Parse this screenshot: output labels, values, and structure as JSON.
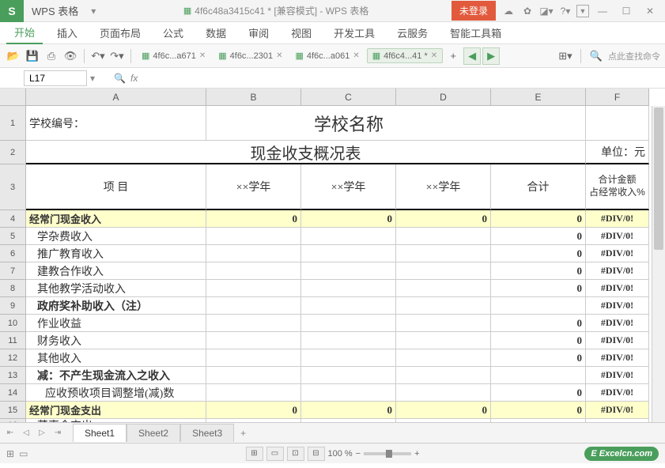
{
  "titlebar": {
    "app": "WPS 表格",
    "file": "4f6c48a3415c41 * [兼容模式] - WPS 表格",
    "login": "未登录"
  },
  "menu": {
    "tabs": [
      "开始",
      "插入",
      "页面布局",
      "公式",
      "数据",
      "审阅",
      "视图",
      "开发工具",
      "云服务",
      "智能工具箱"
    ],
    "active": 0
  },
  "doctabs": [
    {
      "label": "4f6c...a671",
      "active": false
    },
    {
      "label": "4f6c...2301",
      "active": false
    },
    {
      "label": "4f6c...a061",
      "active": false
    },
    {
      "label": "4f6c4...41 *",
      "active": true
    }
  ],
  "search": "点此查找命令",
  "namebox": {
    "cell": "L17",
    "fx": "fx"
  },
  "cols": [
    "A",
    "B",
    "C",
    "D",
    "E",
    "F"
  ],
  "rows": [
    "1",
    "2",
    "3",
    "4",
    "5",
    "6",
    "7",
    "8",
    "9",
    "10",
    "11",
    "12",
    "13",
    "14",
    "15",
    "16"
  ],
  "sheet": {
    "r1": {
      "a": "学校编号：",
      "title": "学校名称"
    },
    "r2": {
      "title": "现金收支概况表",
      "unit": "单位：元"
    },
    "r3": {
      "a": "项    目",
      "b": "××学年",
      "c": "××学年",
      "d": "××学年",
      "e": "合计",
      "f1": "合计金额",
      "f2": "占经常收入%"
    },
    "dataRows": [
      {
        "a": "经常门现金收入",
        "b": "0",
        "c": "0",
        "d": "0",
        "e": "0",
        "f": "#DIV/0!",
        "hl": true,
        "bold": true,
        "ind": 0
      },
      {
        "a": "学杂费收入",
        "e": "0",
        "f": "#DIV/0!",
        "ind": 1
      },
      {
        "a": "推广教育收入",
        "e": "0",
        "f": "#DIV/0!",
        "ind": 1
      },
      {
        "a": "建教合作收入",
        "e": "0",
        "f": "#DIV/0!",
        "ind": 1
      },
      {
        "a": "其他教学活动收入",
        "e": "0",
        "f": "#DIV/0!",
        "ind": 1
      },
      {
        "a": "政府奖补助收入（注）",
        "f": "#DIV/0!",
        "ind": 1,
        "bold": true
      },
      {
        "a": "作业收益",
        "e": "0",
        "f": "#DIV/0!",
        "ind": 1
      },
      {
        "a": "财务收入",
        "e": "0",
        "f": "#DIV/0!",
        "ind": 1
      },
      {
        "a": "其他收入",
        "e": "0",
        "f": "#DIV/0!",
        "ind": 1
      },
      {
        "a": "减：不产生现金流入之收入",
        "f": "#DIV/0!",
        "ind": 1,
        "bold": true
      },
      {
        "a": "应收预收项目调整增(减)数",
        "e": "0",
        "f": "#DIV/0!",
        "ind": 2
      },
      {
        "a": "经常门现金支出",
        "b": "0",
        "c": "0",
        "d": "0",
        "e": "0",
        "f": "#DIV/0!",
        "hl": true,
        "bold": true,
        "ind": 0
      },
      {
        "a": "董事会支出",
        "ind": 1
      }
    ]
  },
  "sheets": {
    "tabs": [
      "Sheet1",
      "Sheet2",
      "Sheet3"
    ],
    "active": 0
  },
  "status": {
    "zoom": "100 %",
    "logo": "Excelcn.com"
  }
}
